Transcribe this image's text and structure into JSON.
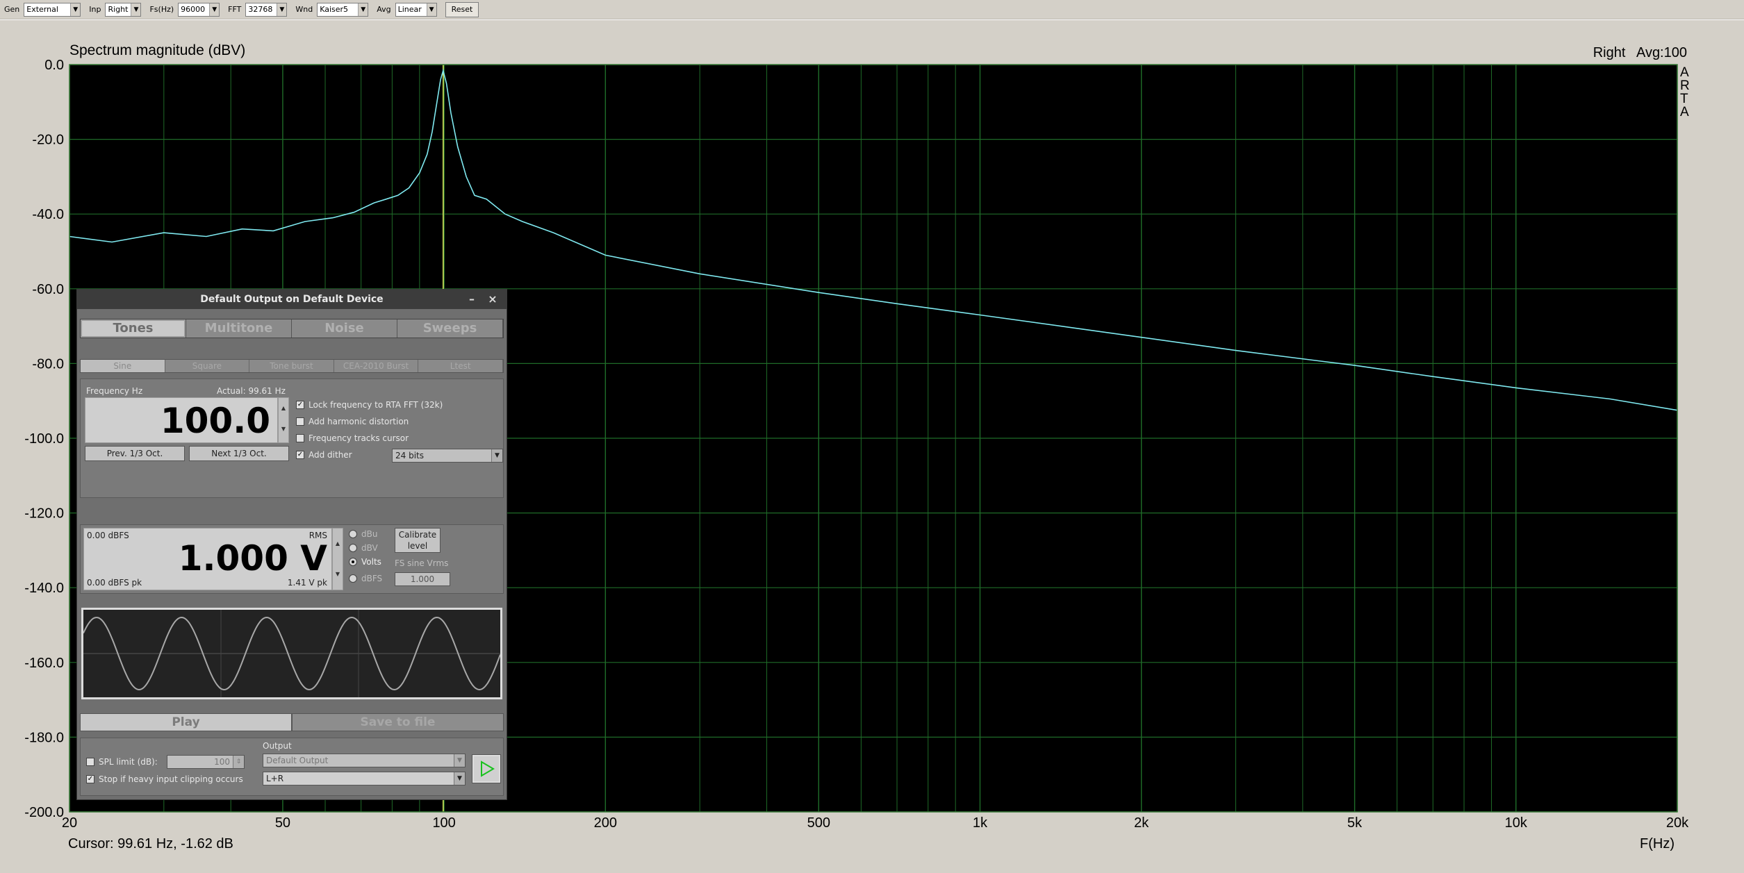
{
  "toolbar": {
    "gen_label": "Gen",
    "gen_value": "External",
    "inp_label": "Inp",
    "inp_value": "Right",
    "fs_label": "Fs(Hz)",
    "fs_value": "96000",
    "fft_label": "FFT",
    "fft_value": "32768",
    "wnd_label": "Wnd",
    "wnd_value": "Kaiser5",
    "avg_label": "Avg",
    "avg_value": "Linear",
    "reset_label": "Reset"
  },
  "plot": {
    "title": "Spectrum magnitude (dBV)",
    "right_info": "Right   Avg:100",
    "arta_label": [
      "A",
      "R",
      "T",
      "A"
    ],
    "cursor_readout": "Cursor: 99.61 Hz, -1.62 dB",
    "xaxis_name": "F(Hz)"
  },
  "chart_data": {
    "type": "line",
    "x_scale": "log",
    "xlim": [
      20,
      20000
    ],
    "ylim": [
      -200,
      0
    ],
    "x_ticks": [
      20,
      50,
      100,
      200,
      500,
      1000,
      2000,
      5000,
      10000,
      20000
    ],
    "x_tick_labels": [
      "20",
      "50",
      "100",
      "200",
      "500",
      "1k",
      "2k",
      "5k",
      "10k",
      "20k"
    ],
    "y_ticks": [
      0,
      -20,
      -40,
      -60,
      -80,
      -100,
      -120,
      -140,
      -160,
      -180,
      -200
    ],
    "y_tick_labels": [
      "0.0",
      "-20.0",
      "-40.0",
      "-60.0",
      "-80.0",
      "-100.0",
      "-120.0",
      "-140.0",
      "-160.0",
      "-180.0",
      "-200.0"
    ],
    "grid": true,
    "background": "#000000",
    "grid_color": "#1f6b28",
    "trace_color": "#7fe9f0",
    "cursor_color": "#d6e35c",
    "cursor_x": 99.61,
    "series": [
      {
        "x": [
          20,
          24,
          30,
          36,
          42,
          48,
          55,
          62,
          68,
          74,
          78,
          82,
          86,
          90,
          93,
          95,
          97,
          98.5,
          99.61,
          101,
          103,
          106,
          110,
          114,
          120,
          130,
          140,
          160,
          200,
          300,
          500,
          700,
          1000,
          1500,
          2000,
          3000,
          5000,
          7000,
          10000,
          15000,
          20000
        ],
        "y": [
          -46,
          -47.5,
          -45,
          -46,
          -44,
          -44.5,
          -42,
          -41,
          -39.5,
          -37,
          -36,
          -35,
          -33,
          -29,
          -24,
          -18,
          -10,
          -4,
          -1.62,
          -5,
          -13,
          -22,
          -30,
          -35,
          -36,
          -40,
          -42,
          -45,
          -51,
          -56,
          -61,
          -64,
          -67,
          -70.5,
          -73,
          -76.5,
          -80.5,
          -83.5,
          -86.5,
          -89.5,
          -92.5
        ]
      }
    ]
  },
  "generator": {
    "title": "Default Output on Default Device",
    "minimize": "–",
    "close": "×",
    "tabs": [
      "Tones",
      "Multitone",
      "Noise",
      "Sweeps"
    ],
    "subtabs": [
      "Sine",
      "Square",
      "Tone burst",
      "CEA-2010 Burst",
      "Ltest"
    ],
    "freq_label": "Frequency Hz",
    "freq_actual": "Actual: 99.61 Hz",
    "freq_value": "100.0",
    "prev_btn": "Prev. 1/3 Oct.",
    "next_btn": "Next 1/3 Oct.",
    "lock_freq": "Lock frequency to RTA FFT (32k)",
    "add_harmonic": "Add harmonic distortion",
    "freq_tracks": "Frequency tracks cursor",
    "add_dither": "Add dither",
    "dither_bits": "24 bits",
    "level_dbfs": "0.00 dBFS",
    "level_rms": "RMS",
    "level_value": "1.000 V",
    "level_pk_dbfs": "0.00 dBFS pk",
    "level_vpk": "1.41 V pk",
    "unit_dbu": "dBu",
    "unit_dbv": "dBV",
    "unit_volts": "Volts",
    "unit_dbfs": "dBFS",
    "calibrate": "Calibrate level",
    "fs_sine_label": "FS sine Vrms",
    "fs_sine_value": "1.000",
    "play": "Play",
    "save": "Save to file",
    "spl_limit": "SPL limit (dB):",
    "spl_value": "100",
    "stop_clip": "Stop if heavy input clipping occurs",
    "output_label": "Output",
    "output_value": "Default Output",
    "channel_value": "L+R"
  }
}
